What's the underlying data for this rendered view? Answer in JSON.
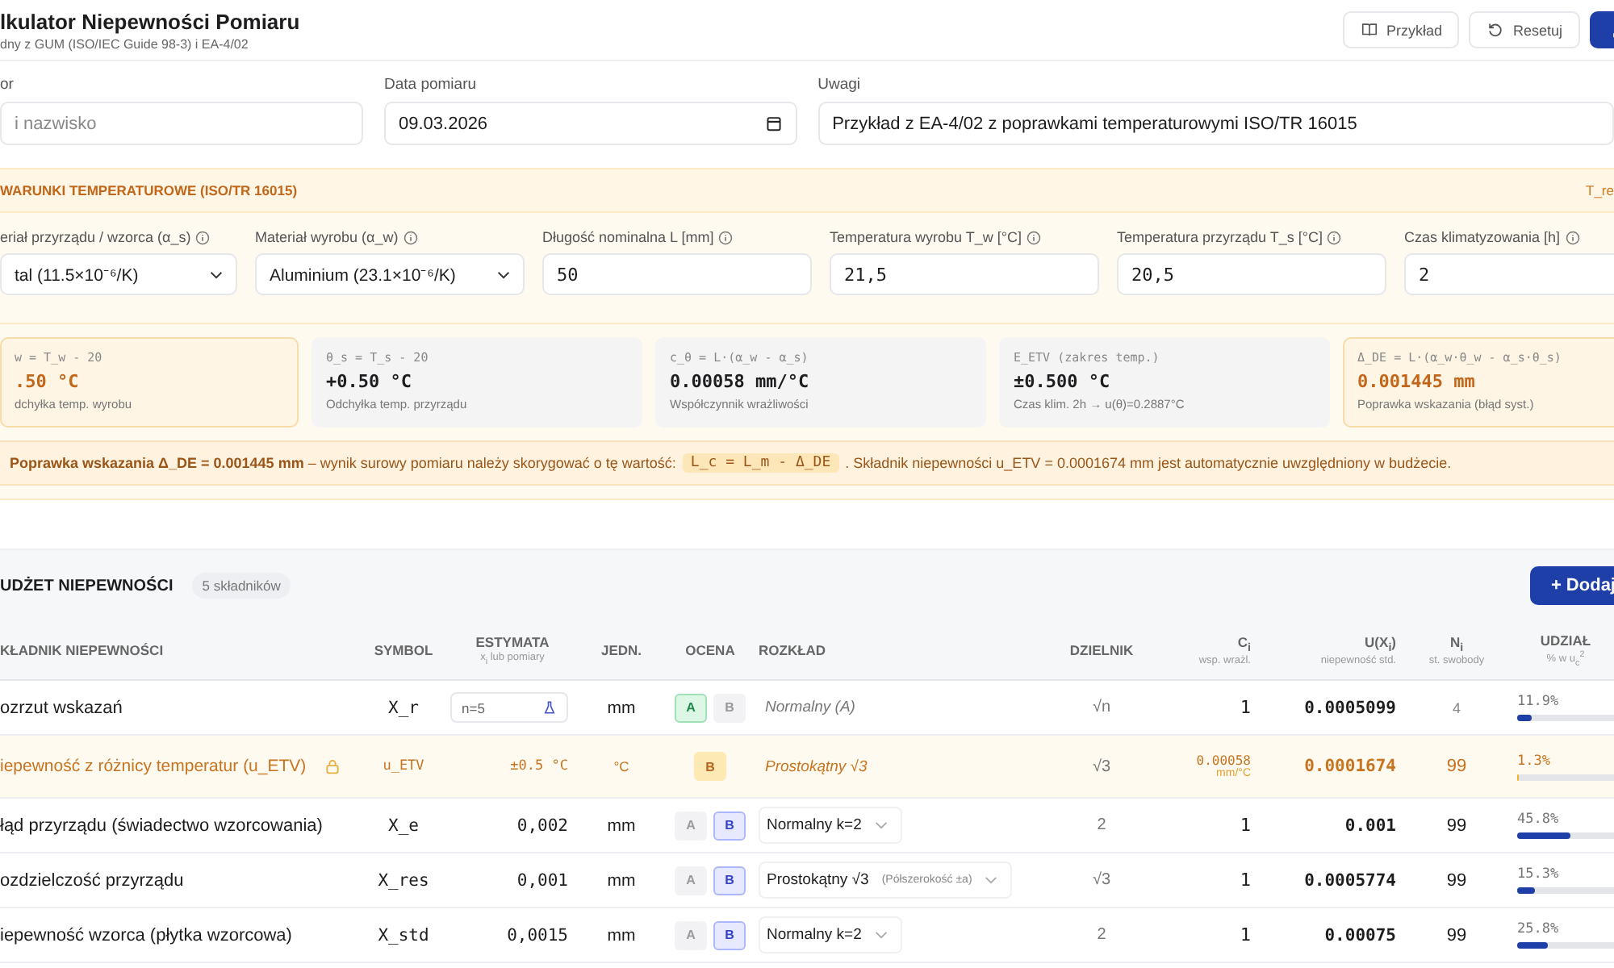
{
  "header": {
    "title": "lkulator Niepewności Pomiaru",
    "subtitle": "dny z GUM (ISO/IEC Guide 98-3) i EA-4/02",
    "buttons": [
      {
        "label": "Przykład",
        "kind": "example"
      },
      {
        "label": "Resetuj",
        "kind": "reset"
      },
      {
        "kind": "export"
      }
    ]
  },
  "form": [
    {
      "label": "or",
      "placeholder": "i nazwisko",
      "kind": "text"
    },
    {
      "label": "Data pomiaru",
      "value": "09.03.2026",
      "kind": "date"
    },
    {
      "label": "Uwagi",
      "value": "Przykład z EA-4/02 z poprawkami temperaturowymi ISO/TR 16015",
      "kind": "text"
    }
  ],
  "temperature": {
    "title": "WARUNKI TEMPERATUROWE (ISO/TR 16015)",
    "right_note": "T_re",
    "fields": [
      {
        "label": "eriał przyrządu / wzorca (α_s)",
        "value": "tal (11.5×10⁻⁶/K)",
        "kind": "select"
      },
      {
        "label": "Materiał wyrobu (α_w)",
        "value": "Aluminium (23.1×10⁻⁶/K)",
        "kind": "select"
      },
      {
        "label": "Długość nominalna L [mm]",
        "value": "50",
        "kind": "input"
      },
      {
        "label": "Temperatura wyrobu T_w [°C]",
        "value": "21,5",
        "kind": "input"
      },
      {
        "label": "Temperatura przyrządu T_s [°C]",
        "value": "20,5",
        "kind": "input"
      },
      {
        "label": "Czas klimatyzowania [h]",
        "value": "2",
        "kind": "input"
      }
    ],
    "cards": [
      {
        "formula": "w = T_w - 20",
        "value": ".50 °C",
        "caption": "dchyłka temp. wyrobu",
        "highlighted": true
      },
      {
        "formula": "θ_s = T_s - 20",
        "value": "+0.50 °C",
        "caption": "Odchyłka temp. przyrządu",
        "highlighted": false
      },
      {
        "formula": "c_θ = L·(α_w - α_s)",
        "value": "0.00058 mm/°C",
        "caption": "Współczynnik wrażliwości",
        "highlighted": false
      },
      {
        "formula": "E_ETV (zakres temp.)",
        "value": "±0.500 °C",
        "caption": "Czas klim. 2h → u(θ)=0.2887°C",
        "highlighted": false
      },
      {
        "formula": "Δ_DE = L·(α_w·θ_w - α_s·θ_s)",
        "value": "0.001445 mm",
        "caption": "Poprawka wskazania (błąd syst.)",
        "highlighted": true
      }
    ],
    "notice": {
      "lead": "**Poprawka wskazania Δ_DE = 0.001445 mm** – wynik surowy pomiaru należy skorygować o tę wartość:",
      "formula": "L_c = L_m - Δ_DE",
      "tail": ". Składnik niepewności u_ETV = 0.0001674 mm jest automatycznie uwzględniony w budżecie."
    }
  },
  "budget": {
    "title": "UDŻET NIEPEWNOŚCI",
    "count": "5 składników",
    "add_button": "+ Dodaj",
    "columns": [
      {
        "label": "KŁADNIK NIEPEWNOŚCI"
      },
      {
        "label": "SYMBOL"
      },
      {
        "label": "ESTYMATA",
        "sub": "x$_{i}$ lub pomiary"
      },
      {
        "label": "JEDN."
      },
      {
        "label": "OCENA"
      },
      {
        "label": "ROZKŁAD"
      },
      {
        "label": "DZIELNIK"
      },
      {
        "label": "C$_{i}$",
        "sub": "wsp. wrażl."
      },
      {
        "label": "U(X$_{i}$)",
        "sub": "niepewność std."
      },
      {
        "label": "N$_{i}$",
        "sub": "st. swobody"
      },
      {
        "label": "UDZIAŁ",
        "sub": "% w u$_{c}$$^{2}$"
      }
    ],
    "rows": [
      {
        "kind": "measured",
        "name": "ozrzut wskazań",
        "symbol": "X_r",
        "estimate": "n=5",
        "unit": "mm",
        "ratings": [
          {
            "label": "A",
            "selected": true
          },
          {
            "label": "B",
            "selected": false
          }
        ],
        "distribution": "Normalny (A)",
        "divisor": "√n",
        "ci": "1",
        "u": "0.0005099",
        "dof": "4",
        "share": "11.9%",
        "level": 0.119
      },
      {
        "kind": "auto",
        "name": "iepewność z różnicy temperatur (u_ETV)",
        "symbol": "u_ETV",
        "estimate": "±0.5 °C",
        "unit": "°C",
        "ratings": [
          {
            "label": "B",
            "selected": true
          }
        ],
        "distribution": "Prostokątny √3",
        "divisor": "√3",
        "ci": "0.00058",
        "ci_unit": "mm/°C",
        "u": "0.0001674",
        "dof": "99",
        "share": "1.3%",
        "level": 0.013
      },
      {
        "kind": "manual",
        "name": "łąd przyrządu (świadectwo wzorcowania)",
        "symbol": "X_e",
        "estimate": "0,002",
        "unit": "mm",
        "ratings": [
          {
            "label": "A",
            "selected": false
          },
          {
            "label": "B",
            "selected": true
          }
        ],
        "distribution": "Normalny k=2",
        "divisor": "2",
        "ci": "1",
        "u": "0.001",
        "dof": "99",
        "share": "45.8%",
        "level": 0.458
      },
      {
        "kind": "manual",
        "name": "ozdzielczość przyrządu",
        "symbol": "X_res",
        "estimate": "0,001",
        "unit": "mm",
        "ratings": [
          {
            "label": "A",
            "selected": false
          },
          {
            "label": "B",
            "selected": true
          }
        ],
        "distribution": "Prostokątny √3",
        "distribution_note": "(Półszerokość ±a)",
        "divisor": "√3",
        "ci": "1",
        "u": "0.0005774",
        "dof": "99",
        "share": "15.3%",
        "level": 0.153
      },
      {
        "kind": "manual",
        "name": "iepewność wzorca (płytka wzorcowa)",
        "symbol": "X_std",
        "estimate": "0,0015",
        "unit": "mm",
        "ratings": [
          {
            "label": "A",
            "selected": false
          },
          {
            "label": "B",
            "selected": true
          }
        ],
        "distribution": "Normalny k=2",
        "divisor": "2",
        "ci": "1",
        "u": "0.00075",
        "dof": "99",
        "share": "25.8%",
        "level": 0.258
      }
    ]
  }
}
